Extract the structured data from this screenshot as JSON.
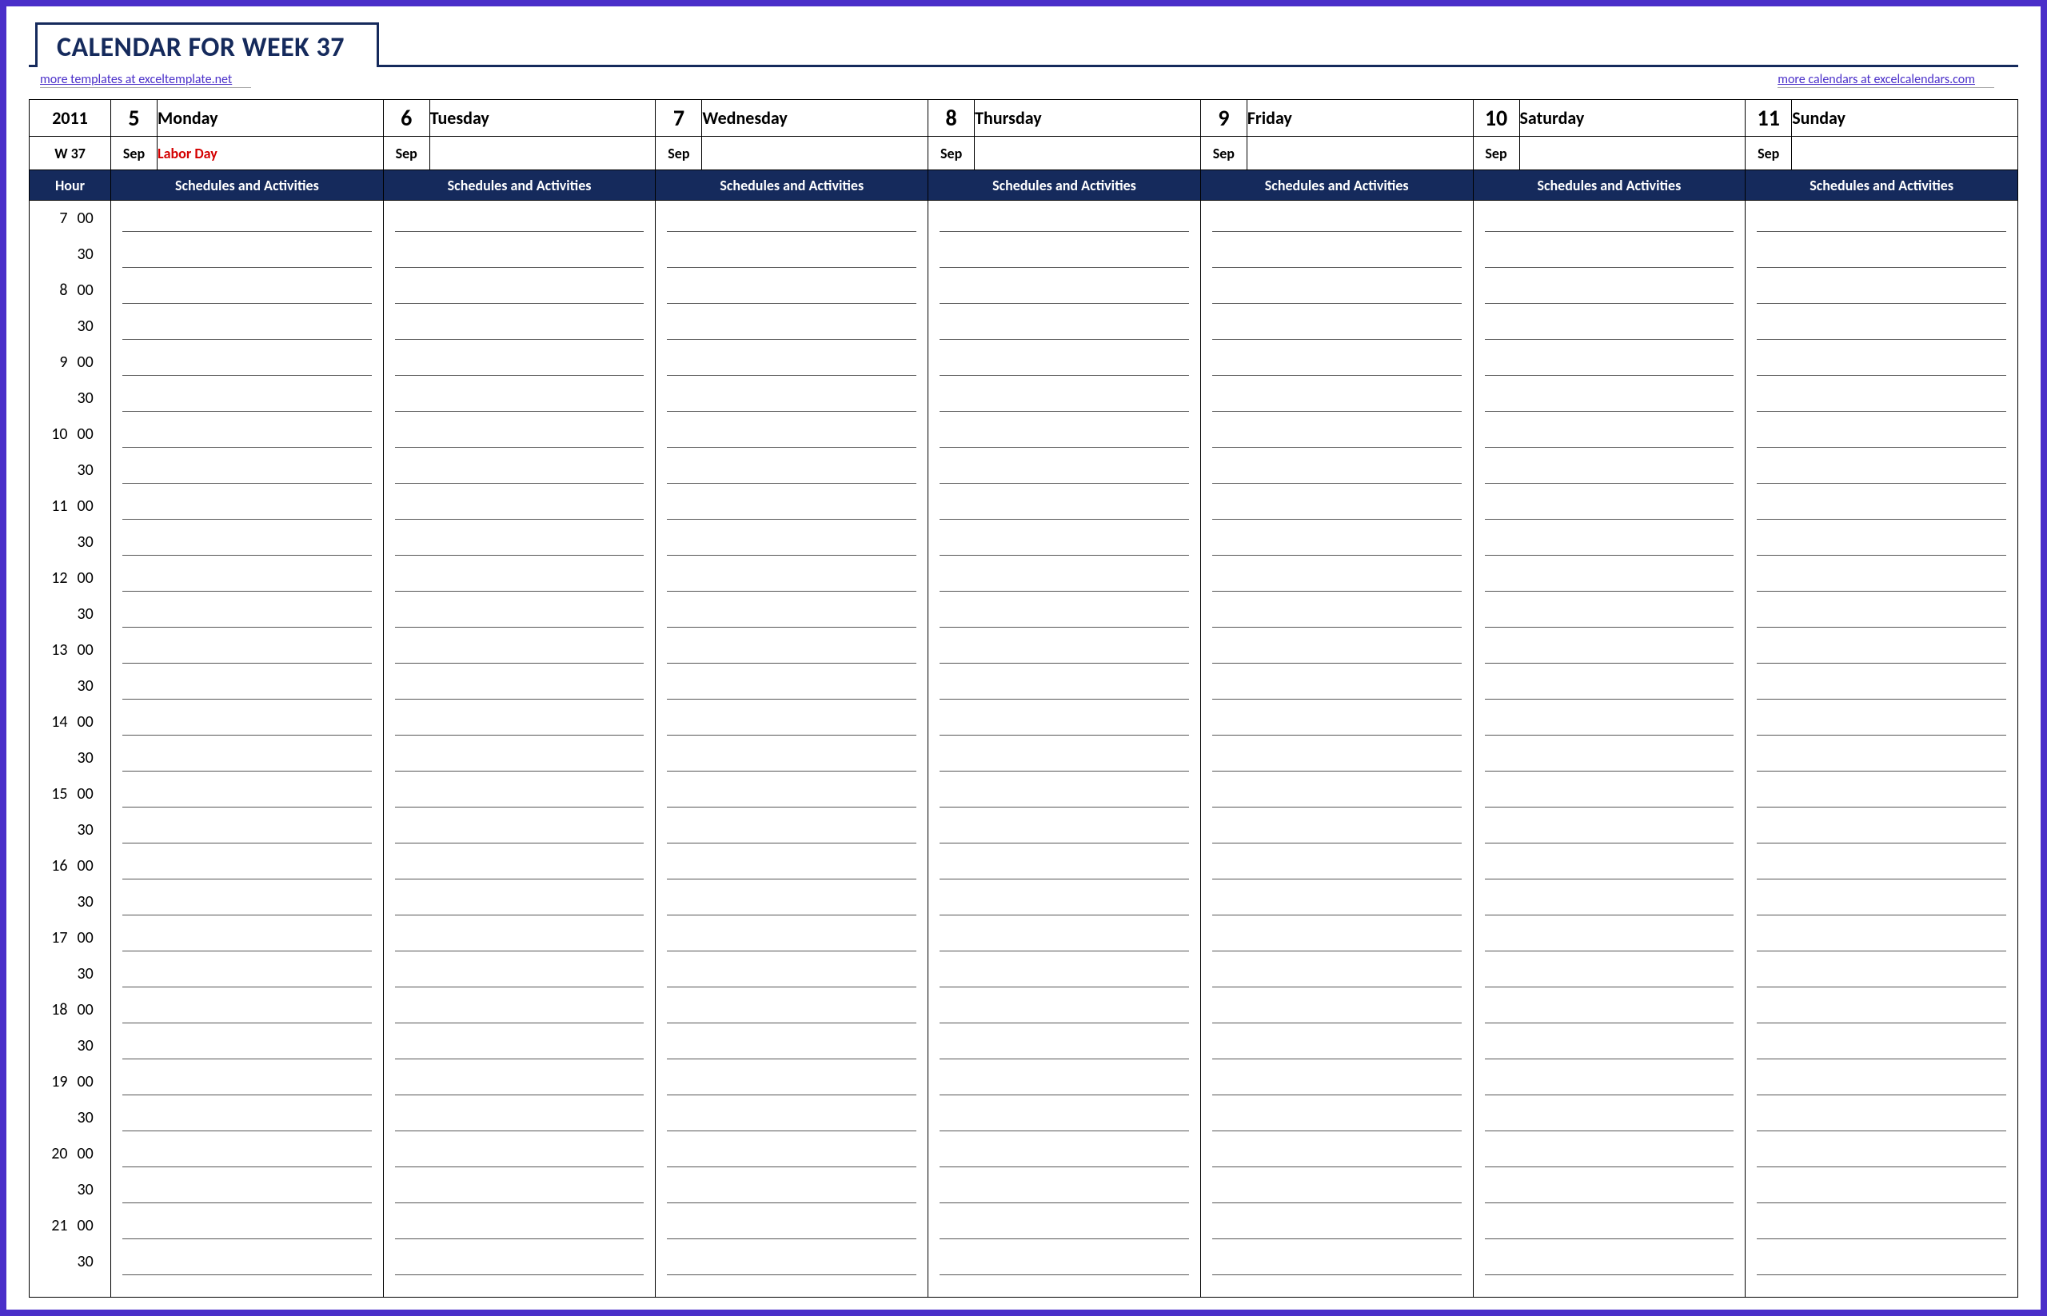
{
  "title": "CALENDAR FOR WEEK 37",
  "links": {
    "left": "more templates at exceltemplate.net",
    "right": "more calendars at excelcalendars.com"
  },
  "year": "2011",
  "week_label": "W 37",
  "hour_header": "Hour",
  "schedules_header": "Schedules and Activities",
  "days": [
    {
      "date": "5",
      "month": "Sep",
      "name": "Monday",
      "event": "Labor Day"
    },
    {
      "date": "6",
      "month": "Sep",
      "name": "Tuesday",
      "event": ""
    },
    {
      "date": "7",
      "month": "Sep",
      "name": "Wednesday",
      "event": ""
    },
    {
      "date": "8",
      "month": "Sep",
      "name": "Thursday",
      "event": ""
    },
    {
      "date": "9",
      "month": "Sep",
      "name": "Friday",
      "event": ""
    },
    {
      "date": "10",
      "month": "Sep",
      "name": "Saturday",
      "event": ""
    },
    {
      "date": "11",
      "month": "Sep",
      "name": "Sunday",
      "event": ""
    }
  ],
  "hours": [
    7,
    8,
    9,
    10,
    11,
    12,
    13,
    14,
    15,
    16,
    17,
    18,
    19,
    20,
    21
  ],
  "minutes": [
    "00",
    "30"
  ]
}
